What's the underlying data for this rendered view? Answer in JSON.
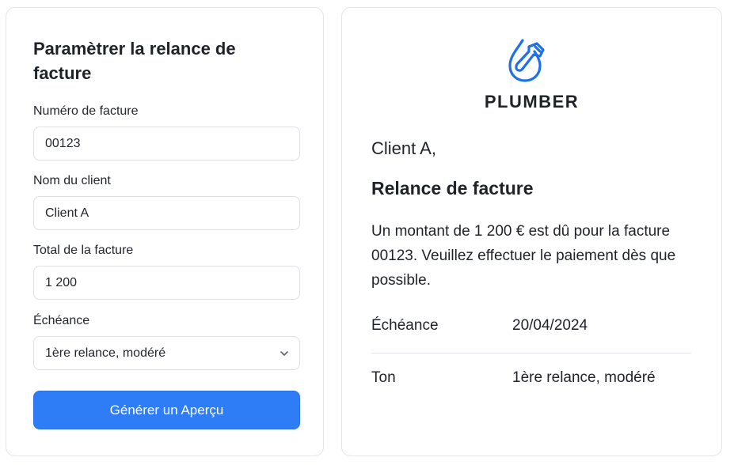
{
  "form": {
    "title": "Paramètrer la relance de facture",
    "invoice_number_label": "Numéro de facture",
    "invoice_number_value": "00123",
    "client_name_label": "Nom du client",
    "client_name_value": "Client A",
    "invoice_total_label": "Total de la facture",
    "invoice_total_value": "1 200",
    "due_label": "Échéance",
    "due_selected": "1ère relance, modéré",
    "generate_button": "Générer un Aperçu"
  },
  "preview": {
    "brand": "PLUMBER",
    "greeting": "Client A,",
    "heading": "Relance de facture",
    "body": "Un montant de 1 200 € est dû pour la facture 00123. Veuillez effectuer le paiement dès que possible.",
    "details": [
      {
        "key": "Échéance",
        "value": "20/04/2024"
      },
      {
        "key": "Ton",
        "value": "1ère relance, modéré"
      }
    ]
  },
  "colors": {
    "accent": "#2e7cf6",
    "logo": "#1f6fe8",
    "border": "#e3e6ea"
  },
  "icons": {
    "logo": "water-drop-wrench-icon",
    "select": "chevron-down-icon"
  }
}
